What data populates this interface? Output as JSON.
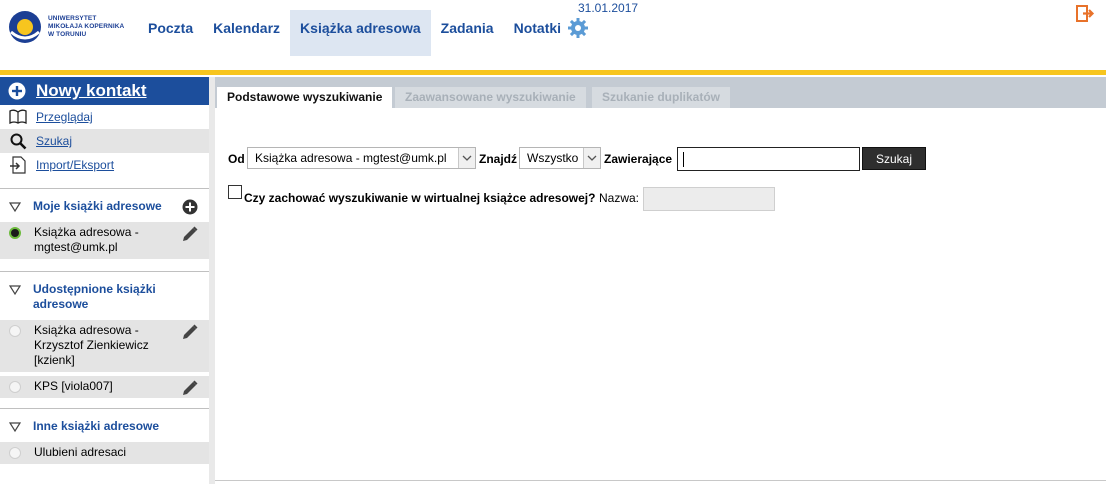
{
  "logo": {
    "lines": [
      "UNIWERSYTET",
      "MIKOŁAJA KOPERNIKA",
      "W TORUNIU"
    ],
    "brand_color": "#1c3f94",
    "accent_color": "#f7c51e"
  },
  "nav": {
    "items": [
      {
        "label": "Poczta",
        "active": false
      },
      {
        "label": "Kalendarz",
        "active": false
      },
      {
        "label": "Książka adresowa",
        "active": true
      },
      {
        "label": "Zadania",
        "active": false
      },
      {
        "label": "Notatki",
        "active": false
      }
    ],
    "settings_icon": "gear-icon",
    "logout_icon": "logout-icon"
  },
  "date": "31.01.2017",
  "sidebar": {
    "new_contact": "Nowy kontakt",
    "actions": [
      {
        "label": "Przeglądaj",
        "icon": "book-icon"
      },
      {
        "label": "Szukaj",
        "icon": "search-icon"
      },
      {
        "label": "Import/Eksport",
        "icon": "import-export-icon"
      }
    ],
    "sections": [
      {
        "title": "Moje książki adresowe",
        "books": [
          {
            "label": "Książka adresowa - mgtest@umk.pl",
            "selected": true,
            "editable": true
          }
        ]
      },
      {
        "title": "Udostępnione książki adresowe",
        "books": [
          {
            "label": "Książka adresowa - Krzysztof Zienkiewicz [kzienk]",
            "selected": false,
            "editable": true
          },
          {
            "label": "KPS [viola007]",
            "selected": false,
            "editable": true
          }
        ]
      },
      {
        "title": "Inne książki adresowe",
        "books": [
          {
            "label": "Ulubieni adresaci",
            "selected": false,
            "editable": false
          }
        ]
      }
    ]
  },
  "tabs": [
    {
      "label": "Podstawowe wyszukiwanie",
      "active": true
    },
    {
      "label": "Zaawansowane wyszukiwanie",
      "active": false
    },
    {
      "label": "Szukanie duplikatów",
      "active": false
    }
  ],
  "search": {
    "from_label": "Od",
    "from_value": "Książka adresowa - mgtest@umk.pl",
    "find_label": "Znajdź",
    "find_value": "Wszystko",
    "contains_label": "Zawierające",
    "query_value": "",
    "submit_label": "Szukaj",
    "save_question": "Czy zachować wyszukiwanie w wirtualnej książce adresowej?",
    "name_label": "Nazwa:",
    "name_value": ""
  }
}
